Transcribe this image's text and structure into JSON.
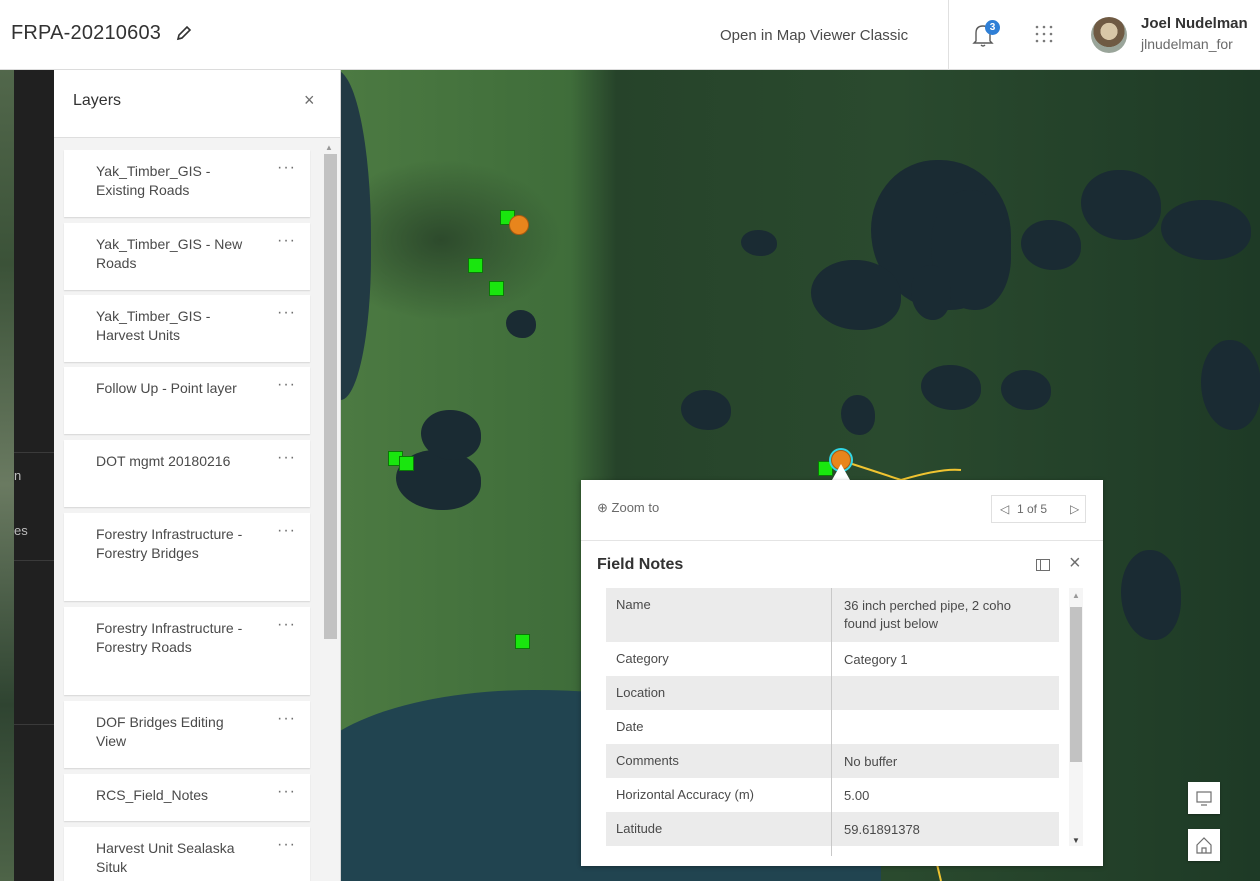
{
  "header": {
    "title": "FRPA-20210603",
    "open_classic": "Open in Map Viewer Classic",
    "notification_count": "3",
    "user_name": "Joel Nudelman",
    "user_id": "jlnudelman_for"
  },
  "left_strip": {
    "items": [
      "n",
      "es"
    ]
  },
  "layers": {
    "title": "Layers",
    "close": "×",
    "more": "···",
    "items": [
      "Yak_Timber_GIS - Existing Roads",
      "Yak_Timber_GIS - New Roads",
      "Yak_Timber_GIS - Harvest Units",
      "Follow Up - Point layer",
      "DOT mgmt 20180216",
      "Forestry Infrastructure - Forestry Bridges",
      "Forestry Infrastructure - Forestry Roads",
      "DOF Bridges Editing View",
      "RCS_Field_Notes",
      "Harvest Unit Sealaska Situk"
    ]
  },
  "popup": {
    "zoom_to": "Zoom to",
    "pager": "1 of 5",
    "title": "Field Notes",
    "close": "×",
    "rows": [
      {
        "key": "Name",
        "value": "36 inch perched pipe, 2 coho found just below"
      },
      {
        "key": "Category",
        "value": "Category 1"
      },
      {
        "key": "Location",
        "value": ""
      },
      {
        "key": "Date",
        "value": ""
      },
      {
        "key": "Comments",
        "value": "No buffer"
      },
      {
        "key": "Horizontal Accuracy (m)",
        "value": "5.00"
      },
      {
        "key": "Latitude",
        "value": "59.61891378"
      }
    ]
  },
  "colors": {
    "point_green": "#19e60e",
    "point_orange": "#e8851c",
    "badge_blue": "#2f7fd6",
    "line_yellow": "#f0c431"
  },
  "icons": [
    "edit-icon",
    "bell-icon",
    "apps-grid-icon",
    "zoom-icon",
    "dock-icon",
    "close-icon",
    "screen-icon",
    "home-icon"
  ]
}
